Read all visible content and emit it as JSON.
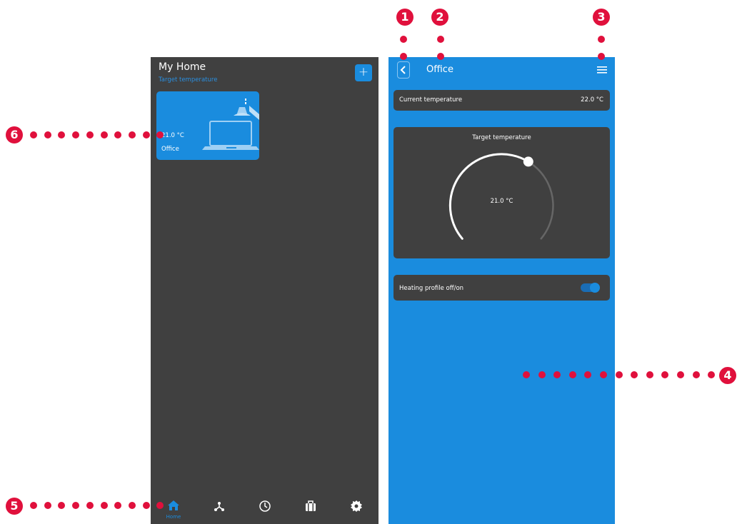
{
  "left_screen": {
    "title": "My Home",
    "subtitle": "Target temperature",
    "add_label": "+",
    "room_card": {
      "temperature": "21.0 °C",
      "name": "Office"
    },
    "nav": {
      "home_label": "Home",
      "items": [
        "home-icon",
        "network-icon",
        "clock-icon",
        "briefcase-icon",
        "gear-icon"
      ]
    }
  },
  "right_screen": {
    "title": "Office",
    "current_temperature": {
      "label": "Current temperature",
      "value": "22.0 °C"
    },
    "target_temperature": {
      "label": "Target temperature",
      "value": "21.0 °C",
      "level": 0.62
    },
    "heating_profile": {
      "label": "Heating profile off/on",
      "enabled": true
    }
  },
  "callouts": [
    "1",
    "2",
    "3",
    "4",
    "5",
    "6"
  ],
  "colors": {
    "accent": "#1a8cde",
    "panel": "#404040",
    "callout": "#e0103c"
  }
}
